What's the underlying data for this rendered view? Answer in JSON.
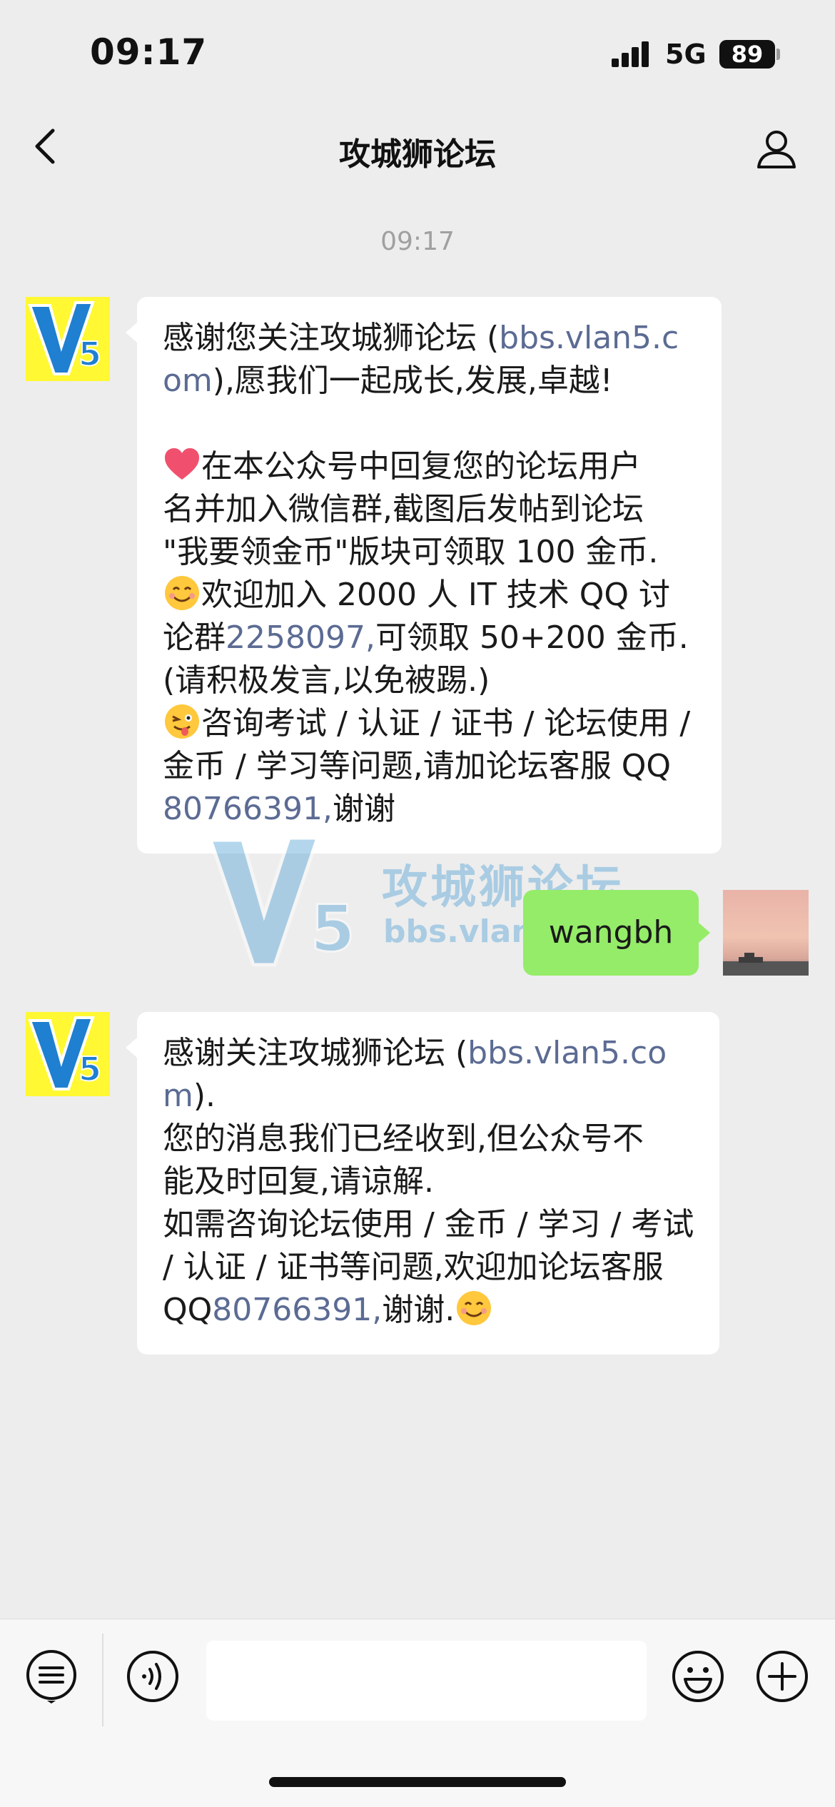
{
  "status_bar": {
    "time": "09:17",
    "network": "5G",
    "battery": "89"
  },
  "nav": {
    "title": "攻城狮论坛",
    "back_icon": "chevron-left-icon",
    "profile_icon": "person-icon"
  },
  "timestamp": "09:17",
  "message1": {
    "lines": [
      {
        "a": "感谢您关注攻城狮论坛 (",
        "link": "bbs.vlan5.c"
      },
      {
        "link": "om",
        "b": "),愿我们一起成长,发展,卓越!"
      },
      {
        "a": " "
      },
      {
        "emoji": "heart-emoji",
        "a": "在本公众号中回复您的论坛用户"
      },
      {
        "a": "名并加入微信群,截图后发帖到论坛"
      },
      {
        "a": "\"我要领金币\"版块可领取 100 金币."
      },
      {
        "emoji": "smile-emoji",
        "a": "欢迎加入 2000 人 IT 技术 QQ 讨"
      },
      {
        "a": "论群",
        "link": "2258097,",
        "b": "可领取 50+200 金币."
      },
      {
        "a": "(请积极发言,以免被踢.)"
      },
      {
        "emoji": "wink-emoji",
        "a": "咨询考试 / 认证 / 证书 / 论坛使用 /"
      },
      {
        "a": "金币 / 学习等问题,请加论坛客服 QQ"
      },
      {
        "link": "80766391,",
        "b": "谢谢"
      }
    ]
  },
  "watermark": {
    "text": "攻城狮论坛",
    "url": "bbs.vlan5.com",
    "logo": "V5"
  },
  "outgoing": {
    "text": "wangbh"
  },
  "message2": {
    "lines": [
      {
        "a": "感谢关注攻城狮论坛 (",
        "link": "bbs.vlan5.co"
      },
      {
        "link": "m",
        "b": ")."
      },
      {
        "a": "您的消息我们已经收到,但公众号不"
      },
      {
        "a": "能及时回复,请谅解."
      },
      {
        "a": "如需咨询论坛使用 / 金币 / 学习 / 考试"
      },
      {
        "a": "/ 认证 / 证书等问题,欢迎加论坛客服"
      },
      {
        "a": "QQ",
        "link": "80766391,",
        "b": "谢谢.",
        "emoji_end": "smile-emoji"
      }
    ]
  },
  "input_bar": {
    "menu_icon": "menu-list-icon",
    "voice_icon": "voice-icon",
    "emoji_icon": "emoji-icon",
    "plus_icon": "plus-icon",
    "input_value": ""
  },
  "colors": {
    "bg": "#ededed",
    "link": "#5b6b93",
    "outgoing_bubble": "#95ec69",
    "avatar_bg": "#fff833"
  }
}
